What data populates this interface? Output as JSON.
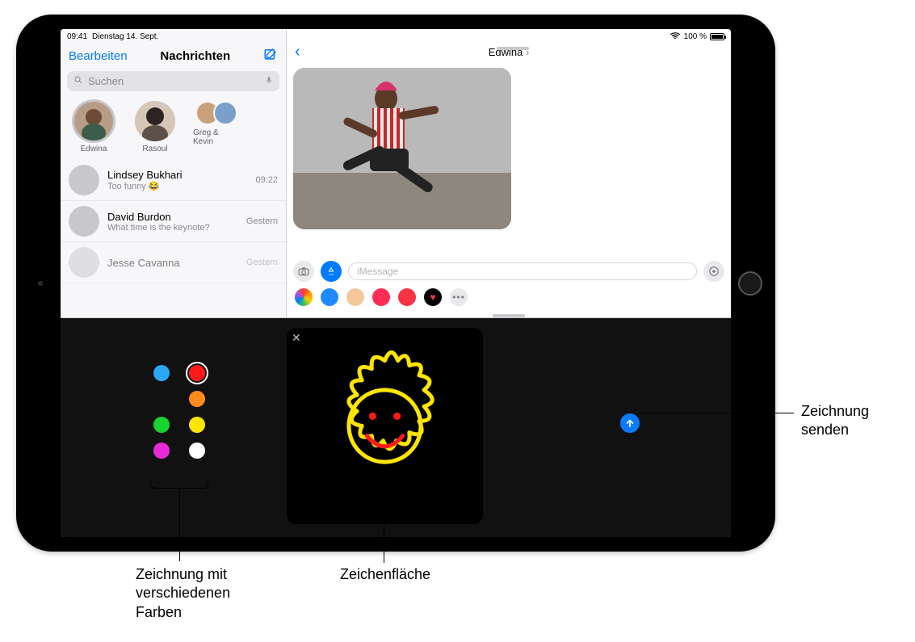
{
  "statusbar": {
    "time": "09:41",
    "date": "Dienstag 14. Sept.",
    "wifi": "wifi",
    "battery_pct": "100 %"
  },
  "sidebar": {
    "edit": "Bearbeiten",
    "title": "Nachrichten",
    "search_placeholder": "Suchen",
    "pins": [
      {
        "name": "Edwina"
      },
      {
        "name": "Rasoul"
      },
      {
        "name": "Greg & Kevin"
      }
    ],
    "rows": [
      {
        "name": "Lindsey Bukhari",
        "preview": "Too funny 😂",
        "time": "09:22"
      },
      {
        "name": "David Burdon",
        "preview": "What time is the keynote?",
        "time": "Gestern"
      },
      {
        "name": "Jesse Cavanna",
        "preview": "",
        "time": "Gestern"
      }
    ]
  },
  "conversation": {
    "title": "Edwina",
    "input_placeholder": "iMessage"
  },
  "digital_touch": {
    "colors": [
      {
        "hex": "#2aa8f5",
        "selected": false
      },
      {
        "hex": "#ff1a1a",
        "selected": true
      },
      {
        "hex": "#ff8c1a",
        "selected": false
      },
      {
        "hex": "#ff8c1a",
        "selected": false
      },
      {
        "hex": "#17d42e",
        "selected": false
      },
      {
        "hex": "#ffe500",
        "selected": false
      },
      {
        "hex": "#e82bd8",
        "selected": false
      },
      {
        "hex": "#ffffff",
        "selected": false
      }
    ],
    "palette_grid": {
      "left": [
        "#2aa8f5",
        "",
        "#17d42e",
        "#e82bd8"
      ],
      "right": [
        "#ff1a1a",
        "#ff8c1a",
        "#ffe500",
        "#ffffff"
      ]
    }
  },
  "callouts": {
    "send": "Zeichnung senden",
    "canvas": "Zeichenfläche",
    "colors": "Zeichnung mit verschiedenen Farben"
  },
  "app_strip_icons": [
    "photos",
    "appstore",
    "memoji",
    "music-pink",
    "music-red",
    "digital-touch",
    "more"
  ]
}
